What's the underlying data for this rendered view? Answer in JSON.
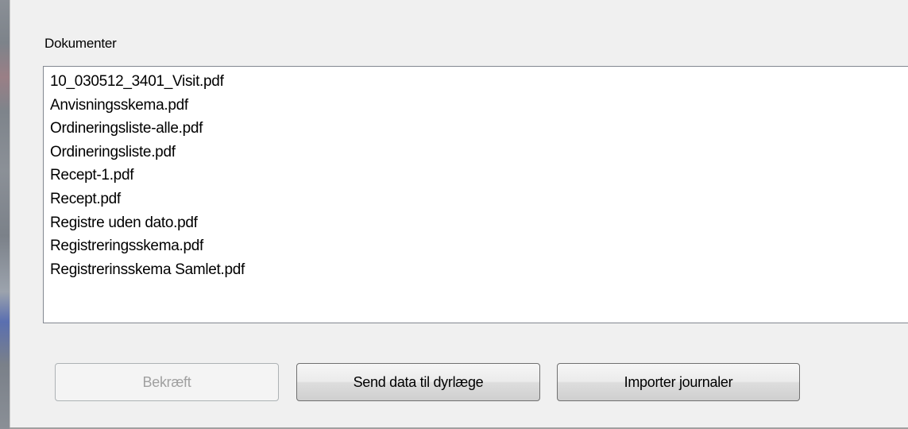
{
  "documents": {
    "label": "Dokumenter",
    "items": [
      "10_030512_3401_Visit.pdf",
      "Anvisningsskema.pdf",
      "Ordineringsliste-alle.pdf",
      "Ordineringsliste.pdf",
      "Recept-1.pdf",
      "Recept.pdf",
      "Registre uden dato.pdf",
      "Registreringsskema.pdf",
      "Registrerinsskema Samlet.pdf"
    ]
  },
  "buttons": {
    "confirm": "Bekræft",
    "send": "Send data til dyrlæge",
    "import": "Importer journaler"
  }
}
